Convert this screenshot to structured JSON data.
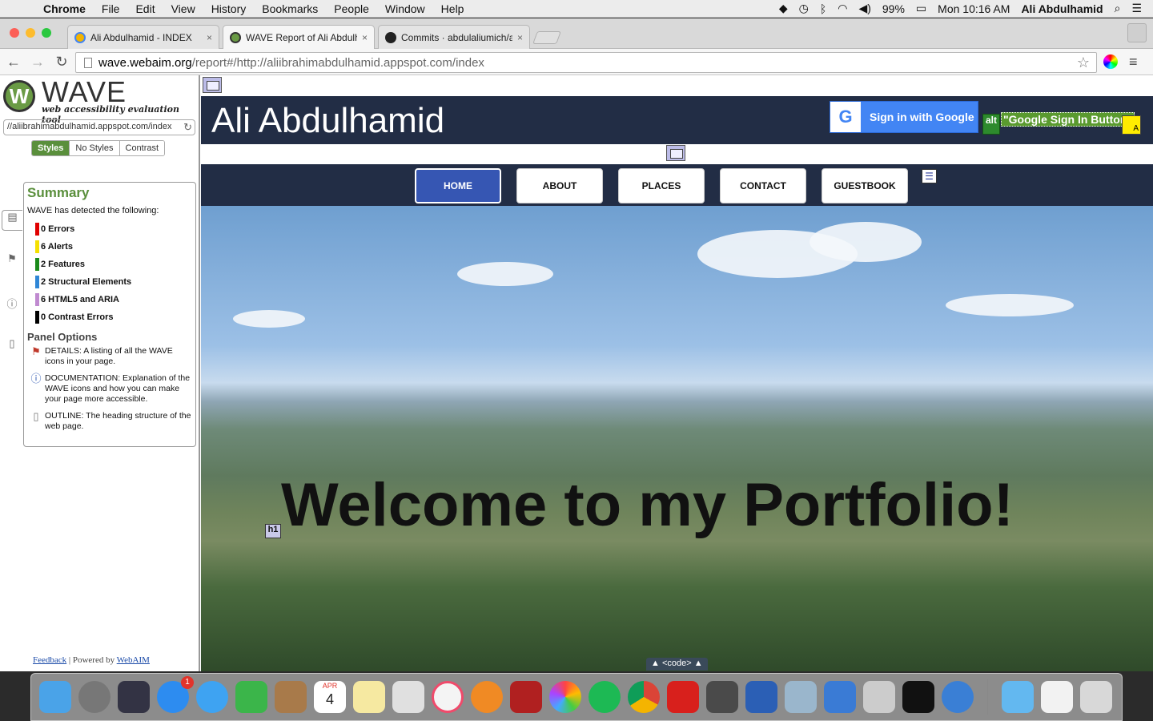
{
  "menubar": {
    "app": "Chrome",
    "items": [
      "File",
      "Edit",
      "View",
      "History",
      "Bookmarks",
      "People",
      "Window",
      "Help"
    ],
    "battery": "99%",
    "clock": "Mon 10:16 AM",
    "user": "Ali Abdulhamid"
  },
  "tabs": [
    {
      "title": "Ali Abdulhamid - INDEX",
      "close": "×"
    },
    {
      "title": "WAVE Report of Ali Abdulh",
      "close": "×"
    },
    {
      "title": "Commits · abdulaliumich/a",
      "close": "×"
    }
  ],
  "omnibox": {
    "host": "wave.webaim.org",
    "path": "/report#/http://aliibrahimabdulhamid.appspot.com/index"
  },
  "wave": {
    "logo_word": "WAVE",
    "tagline": "web accessibility evaluation tool",
    "url": "//aliibrahimabdulhamid.appspot.com/index",
    "style_buttons": [
      "Styles",
      "No Styles",
      "Contrast"
    ],
    "summary_title": "Summary",
    "intro": "WAVE has detected the following:",
    "categories": [
      {
        "label": "0 Errors",
        "color": "#e00000"
      },
      {
        "label": "6 Alerts",
        "color": "#f5e000"
      },
      {
        "label": "2 Features",
        "color": "#1a8a1a"
      },
      {
        "label": "2 Structural Elements",
        "color": "#2f86d6"
      },
      {
        "label": "6 HTML5 and ARIA",
        "color": "#c08ad0"
      },
      {
        "label": "0 Contrast Errors",
        "color": "#000000"
      }
    ],
    "panel_options_title": "Panel Options",
    "options": [
      {
        "text": "DETAILS: A listing of all the WAVE icons in your page.",
        "icon": "flag-icon"
      },
      {
        "text": "DOCUMENTATION: Explanation of the WAVE icons and how you can make your page more accessible.",
        "icon": "info-icon"
      },
      {
        "text": "OUTLINE: The heading structure of the web page.",
        "icon": "document-icon"
      }
    ],
    "footer": {
      "feedback": "Feedback",
      "separator": "|",
      "powered_by": "Powered by",
      "webaim": "WebAIM"
    }
  },
  "site": {
    "title": "Ali Abdulhamid",
    "signin_label": "Sign in with Google",
    "alt_icon_label": "alt",
    "alt_text": "\"Google Sign In Button\"",
    "nav": [
      "HOME",
      "ABOUT",
      "PLACES",
      "CONTACT",
      "GUESTBOOK"
    ],
    "active_nav": "HOME",
    "hero_heading": "Welcome to my Portfolio!",
    "h1_badge": "h1",
    "code_bar": "▲ <code> ▲"
  },
  "dock": {
    "calendar_month": "APR",
    "calendar_day": "4",
    "appstore_badge": "1"
  }
}
